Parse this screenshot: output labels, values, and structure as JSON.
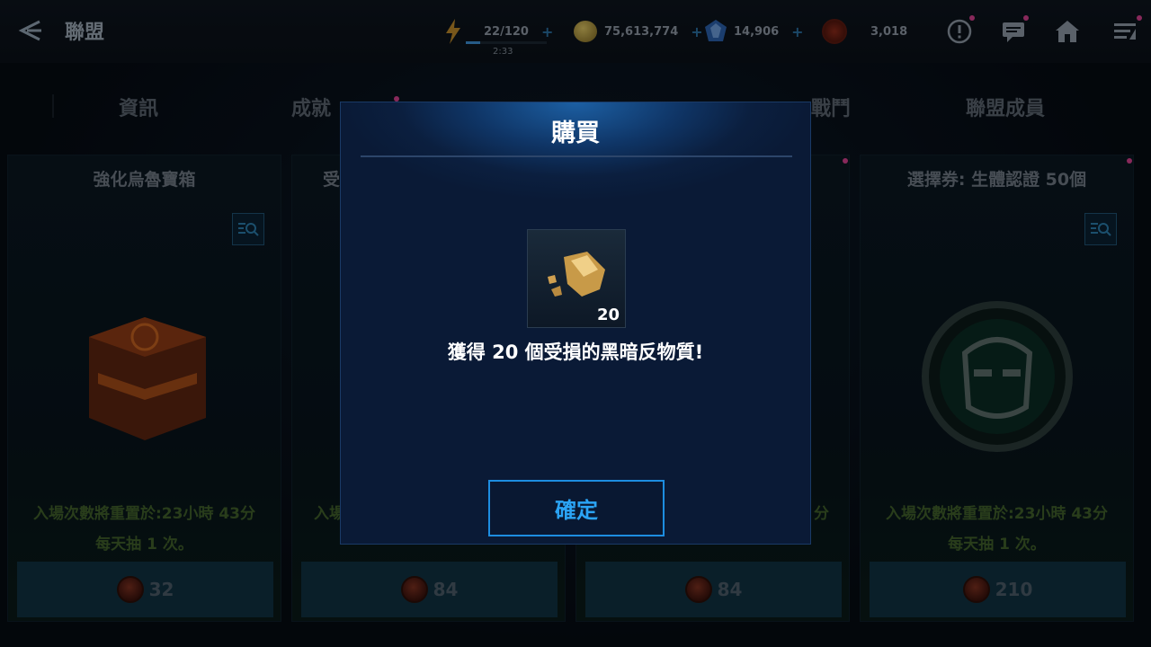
{
  "header": {
    "title": "聯盟",
    "energy": {
      "value": "22/120",
      "timer": "2:33",
      "fill": 0.18
    },
    "gold": "75,613,774",
    "crystals": "14,906",
    "tokens": "3,018",
    "icons": [
      "alert-icon",
      "chat-icon",
      "home-icon",
      "menu-icon"
    ]
  },
  "tabs": [
    {
      "label": "資訊"
    },
    {
      "label": "成就"
    },
    {
      "label": "戰鬥"
    },
    {
      "label": "聯盟成員"
    }
  ],
  "cards": [
    {
      "title": "強化烏魯寶箱",
      "reset": "入場次數將重置於:23小時 43分",
      "daily": "每天抽 1 次。",
      "price": "32"
    },
    {
      "title": "受",
      "reset": "入場",
      "daily": "",
      "price": "84"
    },
    {
      "title": "",
      "reset": "分",
      "daily": "",
      "price": "84"
    },
    {
      "title": "選擇券: 生體認證 50個",
      "reset": "入場次數將重置於:23小時 43分",
      "daily": "每天抽 1 次。",
      "price": "210"
    }
  ],
  "modal": {
    "title": "購買",
    "item_quantity": "20",
    "message": "獲得 20 個受損的黑暗反物質!",
    "confirm_label": "確定"
  },
  "colors": {
    "accent": "#2ba4f5",
    "modal_bg": "#0b1f3f",
    "notification_dot": "#d2408c"
  }
}
